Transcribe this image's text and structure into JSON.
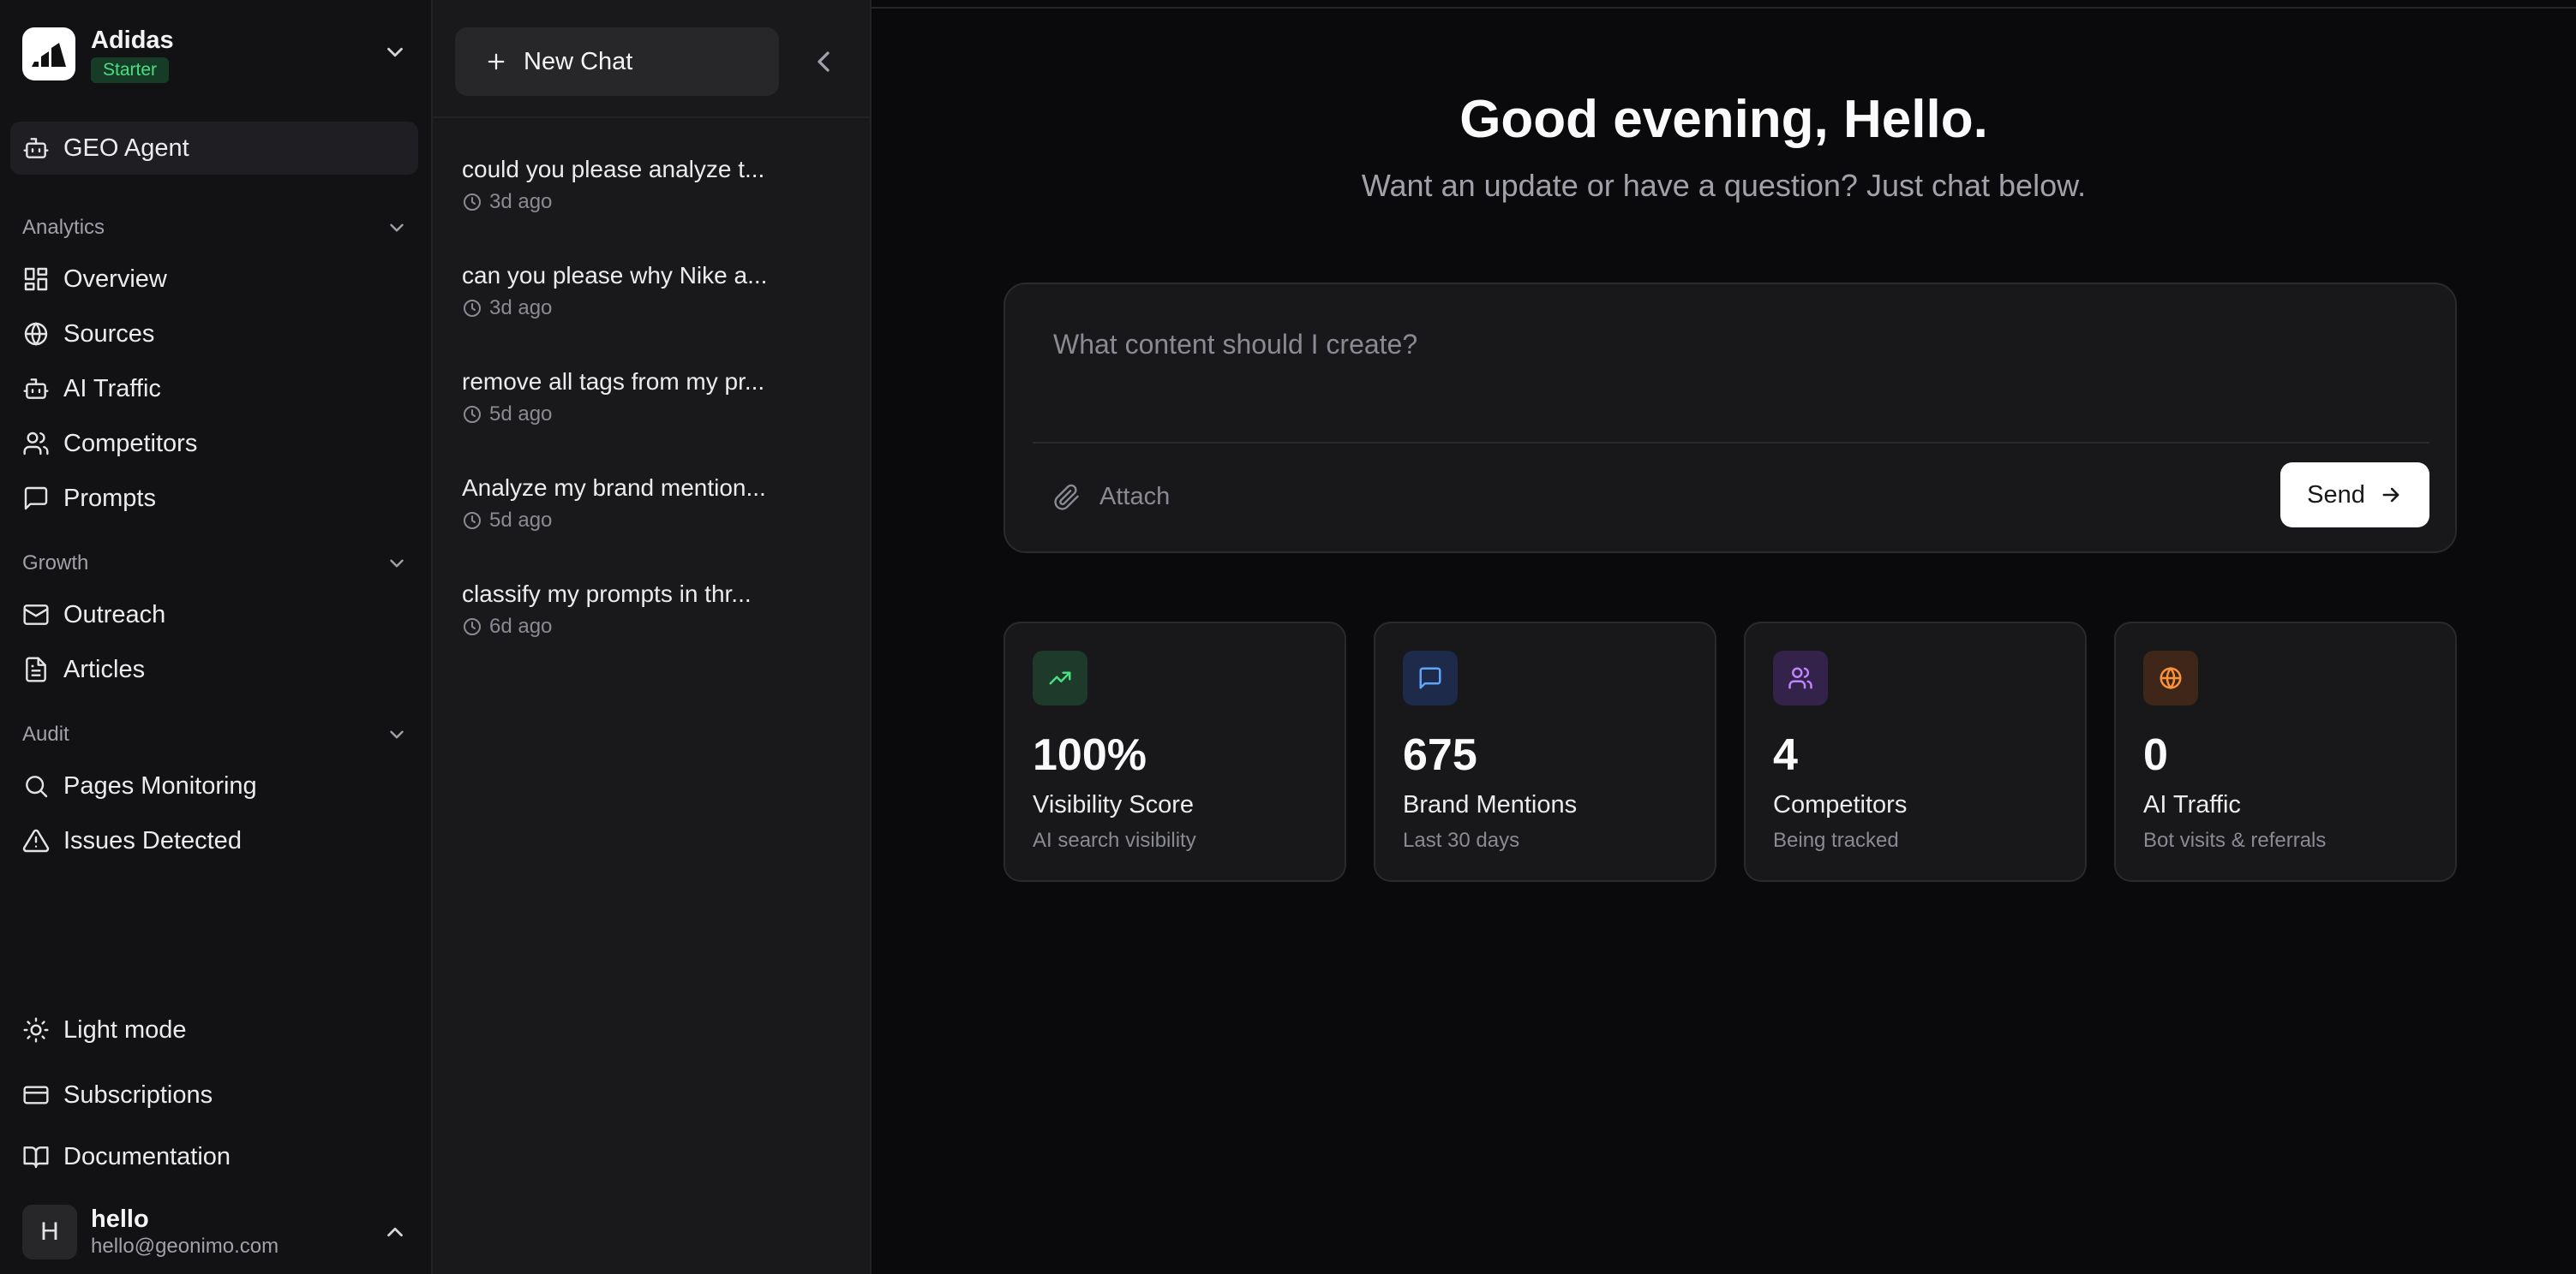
{
  "brand": {
    "name": "Adidas",
    "plan": "Starter"
  },
  "nav": {
    "active": "GEO Agent",
    "sections": [
      {
        "title": "Analytics",
        "items": [
          "Overview",
          "Sources",
          "AI Traffic",
          "Competitors",
          "Prompts"
        ]
      },
      {
        "title": "Growth",
        "items": [
          "Outreach",
          "Articles"
        ]
      },
      {
        "title": "Audit",
        "items": [
          "Pages Monitoring",
          "Issues Detected"
        ]
      }
    ],
    "footer": [
      "Light mode",
      "Subscriptions",
      "Documentation"
    ]
  },
  "user": {
    "initial": "H",
    "name": "hello",
    "email": "hello@geonimo.com"
  },
  "chat_panel": {
    "new_chat_label": "New Chat",
    "chats": [
      {
        "title": "could you please analyze t...",
        "time": "3d ago"
      },
      {
        "title": "can you please why Nike a...",
        "time": "3d ago"
      },
      {
        "title": "remove all tags from my pr...",
        "time": "5d ago"
      },
      {
        "title": "Analyze my brand mention...",
        "time": "5d ago"
      },
      {
        "title": "classify my prompts in thr...",
        "time": "6d ago"
      }
    ]
  },
  "main": {
    "greeting": "Good evening, Hello.",
    "subtitle": "Want an update or have a question? Just chat below.",
    "composer": {
      "placeholder": "What content should I create?",
      "value": "",
      "attach_label": "Attach",
      "send_label": "Send"
    },
    "stats": [
      {
        "value": "100%",
        "title": "Visibility Score",
        "subtitle": "AI search visibility",
        "icon": "trending-up-icon",
        "icon_color": "#4ade80",
        "icon_bg": "#1d3a2a"
      },
      {
        "value": "675",
        "title": "Brand Mentions",
        "subtitle": "Last 30 days",
        "icon": "message-square-icon",
        "icon_color": "#60a5fa",
        "icon_bg": "#1e2a4a"
      },
      {
        "value": "4",
        "title": "Competitors",
        "subtitle": "Being tracked",
        "icon": "users-icon",
        "icon_color": "#c084fc",
        "icon_bg": "#33224a"
      },
      {
        "value": "0",
        "title": "AI Traffic",
        "subtitle": "Bot visits & referrals",
        "icon": "globe-icon",
        "icon_color": "#fb923c",
        "icon_bg": "#3e2718"
      }
    ]
  }
}
